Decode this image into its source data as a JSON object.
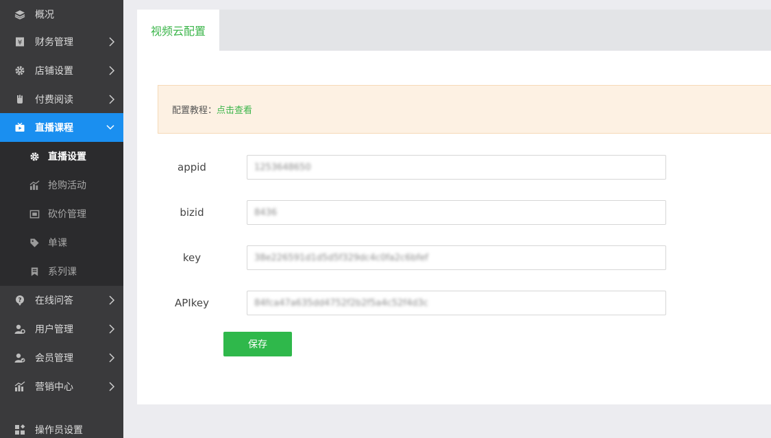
{
  "sidebar": {
    "items": [
      {
        "label": "概况",
        "icon": "layers-icon"
      },
      {
        "label": "财务管理",
        "icon": "ledger-icon"
      },
      {
        "label": "店铺设置",
        "icon": "gear-icon"
      },
      {
        "label": "付费阅读",
        "icon": "hand-icon"
      },
      {
        "label": "直播课程",
        "icon": "live-tv-icon"
      },
      {
        "label": "在线问答",
        "icon": "question-icon"
      },
      {
        "label": "用户管理",
        "icon": "user-gear-icon"
      },
      {
        "label": "会员管理",
        "icon": "member-icon"
      },
      {
        "label": "营销中心",
        "icon": "chart-icon"
      },
      {
        "label": "操作员设置",
        "icon": "widgets-icon"
      }
    ],
    "submenu": [
      {
        "label": "直播设置",
        "icon": "gear-icon"
      },
      {
        "label": "抢购活动",
        "icon": "bar-chart-icon"
      },
      {
        "label": "砍价管理",
        "icon": "cut-price-icon"
      },
      {
        "label": "单课",
        "icon": "tag-icon"
      },
      {
        "label": "系列课",
        "icon": "bookmark-icon"
      }
    ],
    "active_color": "#1a8ff0"
  },
  "tabs": [
    {
      "label": "视频云配置"
    }
  ],
  "notice": {
    "prefix": "配置教程：",
    "link": "点击查看"
  },
  "form": {
    "fields": [
      {
        "label": "appid",
        "value": "1253648650"
      },
      {
        "label": "bizid",
        "value": "8436"
      },
      {
        "label": "key",
        "value": "38e226591d1d5d5f329dc4c0fa2c6bfef"
      },
      {
        "label": "APIkey",
        "value": "84fca47a635dd4752f2b2f5a4c52f4d3c"
      }
    ],
    "save_label": "保存"
  }
}
